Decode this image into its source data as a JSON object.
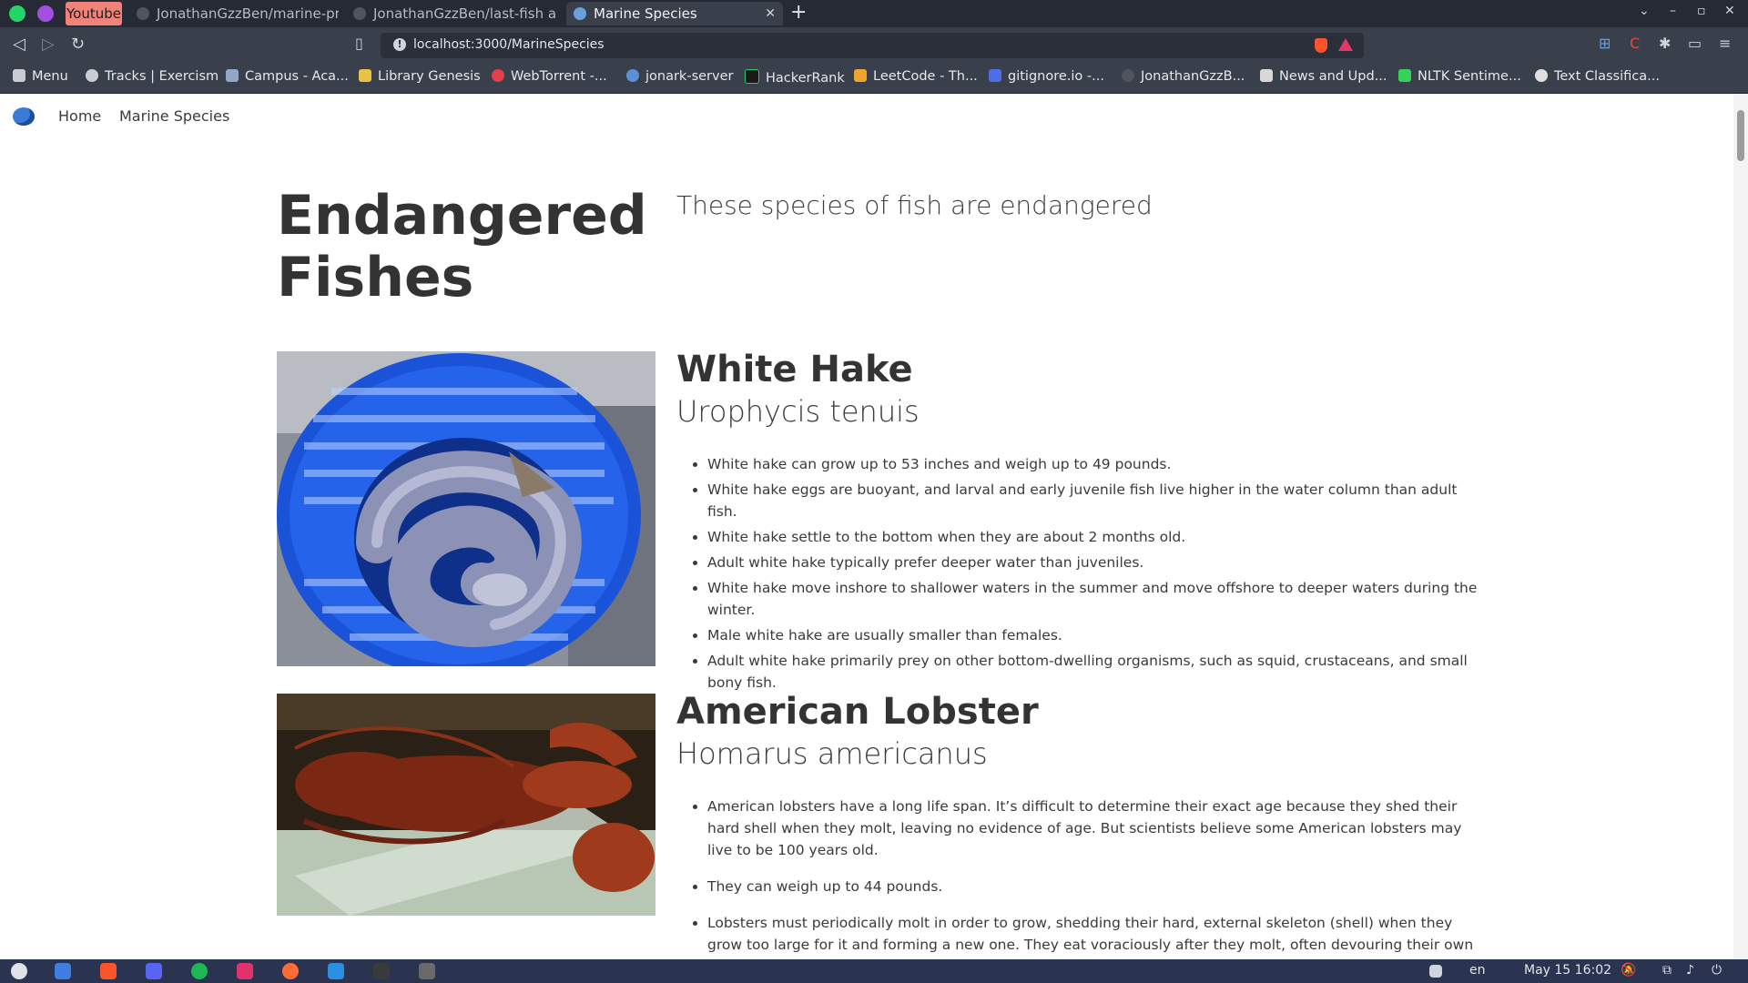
{
  "browser": {
    "tabs": [
      {
        "label": "Youtube"
      },
      {
        "label": "JonathanGzzBen/marine-pres"
      },
      {
        "label": "JonathanGzzBen/last-fish at d"
      },
      {
        "label": "Marine Species",
        "active": true
      }
    ],
    "address": "localhost:3000/MarineSpecies",
    "bookmarks": [
      {
        "label": "Menu",
        "icon": "folder-icon"
      },
      {
        "label": "Tracks | Exercism",
        "icon": "exercism-icon"
      },
      {
        "label": "Campus - Aca...",
        "icon": "campus-icon"
      },
      {
        "label": "Library Genesis",
        "icon": "book-icon"
      },
      {
        "label": "WebTorrent -...",
        "icon": "webtorrent-icon"
      },
      {
        "label": "jonark-server",
        "icon": "server-icon"
      },
      {
        "label": "HackerRank",
        "icon": "hackerrank-icon"
      },
      {
        "label": "LeetCode - Th...",
        "icon": "leetcode-icon"
      },
      {
        "label": "gitignore.io -...",
        "icon": "gitignore-icon"
      },
      {
        "label": "JonathanGzzB...",
        "icon": "github-icon"
      },
      {
        "label": "News and Upd...",
        "icon": "news-icon"
      },
      {
        "label": "NLTK Sentime...",
        "icon": "nltk-icon"
      },
      {
        "label": "Text Classifica...",
        "icon": "globe-icon"
      }
    ]
  },
  "site": {
    "nav": {
      "home": "Home",
      "species": "Marine Species"
    },
    "heading": "Endangered Fishes",
    "lead": "These species of fish are endangered",
    "species": [
      {
        "name": "White Hake",
        "scientific": "Urophycis tenuis",
        "image": "white-hake-in-blue-basket",
        "facts": [
          "White hake can grow up to 53 inches and weigh up to 49 pounds.",
          "White hake eggs are buoyant, and larval and early juvenile fish live higher in the water column than adult fish.",
          "White hake settle to the bottom when they are about 2 months old.",
          "Adult white hake typically prefer deeper water than juveniles.",
          "White hake move inshore to shallower waters in the summer and move offshore to deeper waters during the winter.",
          "Male white hake are usually smaller than females.",
          "Adult white hake primarily prey on other bottom-dwelling organisms, such as squid, crustaceans, and small bony fish."
        ]
      },
      {
        "name": "American Lobster",
        "scientific": "Homarus americanus",
        "image": "american-lobster-on-measuring-board",
        "facts": [
          "American lobsters have a long life span. It’s difficult to determine their exact age because they shed their hard shell when they molt, leaving no evidence of age. But scientists believe some American lobsters may live to be 100 years old.",
          "They can weigh up to 44 pounds.",
          "Lobsters must periodically molt in order to grow, shedding their hard, external skeleton (shell) when they grow too large for it and forming a new one. They eat voraciously after they molt, often devouring their own recently vacated"
        ]
      }
    ]
  },
  "taskbar": {
    "lang": "en",
    "datetime": "May 15  16:02"
  }
}
